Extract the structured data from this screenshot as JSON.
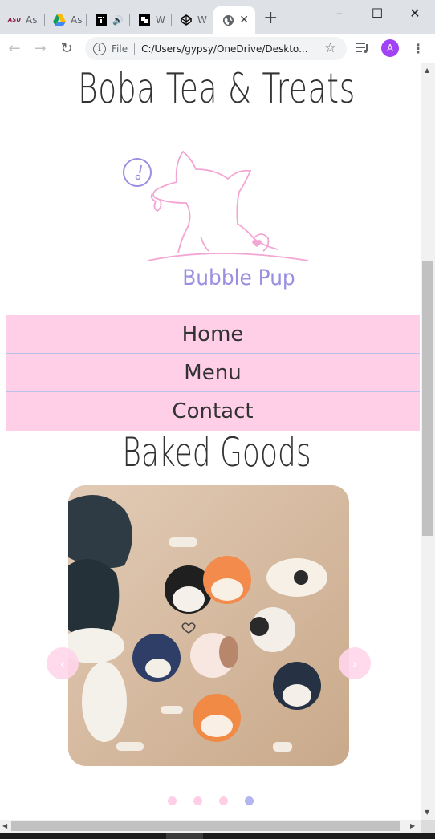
{
  "browser": {
    "tabs": [
      {
        "icon": "asu-icon",
        "label": "As",
        "fav_text": "ASU"
      },
      {
        "icon": "google-drive-icon",
        "label": "As",
        "fav_text": ""
      },
      {
        "icon": "music-player-icon",
        "label": "",
        "fav_text": ""
      },
      {
        "icon": "notes-app-icon",
        "label": "W",
        "fav_text": ""
      },
      {
        "icon": "codepen-icon",
        "label": "W",
        "fav_text": ""
      },
      {
        "icon": "globe-icon",
        "label": "",
        "fav_text": ""
      }
    ],
    "active_tab_index": 5,
    "new_tab_label": "+",
    "window_controls": {
      "minimize": "–",
      "maximize": "☐",
      "close": "✕"
    },
    "address": {
      "scheme": "File",
      "url": "C:/Users/gypsy/OneDrive/Deskto..."
    },
    "avatar_letter": "A"
  },
  "site": {
    "title": "Boba Tea & Treats",
    "logo_text": "Bubble Pup",
    "nav": [
      "Home",
      "Menu",
      "Contact"
    ],
    "section_title": "Baked Goods",
    "carousel": {
      "prev_label": "‹",
      "next_label": "›",
      "dot_count": 4,
      "active_dot": 3
    }
  },
  "colors": {
    "nav_bg": "#ffcfe8",
    "nav_divider": "#b9c3e8",
    "logo_pink": "#f3a6d3",
    "logo_purple": "#9a8fe0",
    "dot_active": "#b3b5f0"
  }
}
